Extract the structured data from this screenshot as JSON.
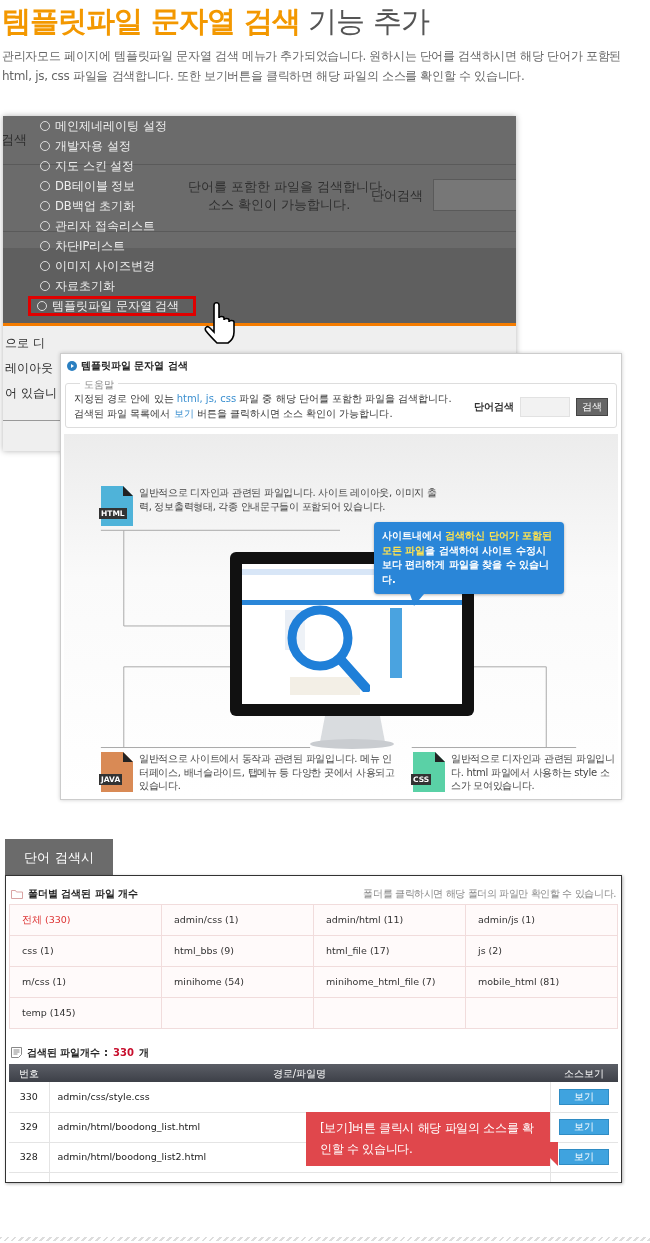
{
  "heading": {
    "highlight": "템플릿파일 문자열 검색",
    "rest": "기능 추가"
  },
  "intro": "관리자모드 페이지에 템플릿파일 문자열 검색 메뉴가 추가되었습니다. 원하시는 단어를 검색하시면 해당 단어가 포함된 html, js, css 파일을 검색합니다. 또한 보기버튼을 클릭하면 해당 파일의 소스를 확인할 수 있습니다.",
  "admin_screenshot": {
    "title_fragment": "검색",
    "help_fragments": [
      "단어를 포함한 파일을 검색합니다.",
      "소스 확인이 가능합니다."
    ],
    "search_label": "단어검색",
    "lower_fragments": [
      "으로 디",
      "레이아웃",
      "어 있습니"
    ],
    "menu": [
      {
        "label": "메인제네레이팅 설정",
        "selected": false
      },
      {
        "label": "개발자용 설정",
        "selected": false
      },
      {
        "label": "지도 스킨 설정",
        "selected": false
      },
      {
        "label": "DB테이블 정보",
        "selected": false
      },
      {
        "label": "DB백업 초기화",
        "selected": false
      },
      {
        "label": "관리자 접속리스트",
        "selected": false
      },
      {
        "label": "차단IP리스트",
        "selected": false
      },
      {
        "label": "이미지 사이즈변경",
        "selected": false
      },
      {
        "label": "자료초기화",
        "selected": false
      },
      {
        "label": "템플릿파일 문자열 검색",
        "selected": true
      }
    ]
  },
  "search_screenshot": {
    "title": "템플릿파일 문자열 검색",
    "help_legend": "도움말",
    "help_lines": [
      [
        {
          "text": "지정된 경로 안에 있는 ",
          "accent": false
        },
        {
          "text": "html, js, css",
          "accent": true
        },
        {
          "text": " 파일 중 해당 단어를 포함한 파일을 검색합니다.",
          "accent": false
        }
      ],
      [
        {
          "text": "검색된 파일 목록에서 ",
          "accent": false
        },
        {
          "text": "보기",
          "accent": true
        },
        {
          "text": " 버튼을 클릭하시면 소스 확인이 가능합니다.",
          "accent": false
        }
      ]
    ],
    "search_label": "단어검색",
    "search_button": "검색",
    "file_notes": [
      {
        "kind": "html",
        "badge": "HTML",
        "color": "#4fb3d9",
        "text": "일반적으로 디자인과 관련된 파일입니다. 사이트 레이아웃, 이미지 출력, 정보출력형태, 각종 안내문구들이 포함되어 있습니다."
      },
      {
        "kind": "java",
        "badge": "JAVA",
        "color": "#d98a55",
        "text": "일반적으로 사이트에서 동작과 관련된 파일입니다. 메뉴 인터페이스, 배너슬라이드, 탭메뉴 등 다양한 곳에서 사용되고 있습니다."
      },
      {
        "kind": "css",
        "badge": "CSS",
        "color": "#5ad1a6",
        "text": "일반적으로 디자인과 관련된 파일입니다. html 파일에서 사용하는 style 소스가 모여있습니다."
      }
    ],
    "callout": [
      {
        "text": "사이트내에서 ",
        "highlight": false
      },
      {
        "text": "검색하신 단어가 포함된 모든 파일",
        "highlight": true
      },
      {
        "text": "을 검색하여 사이트 수정시 보다 편리하게 파일을 찾을 수 있습니다.",
        "highlight": false
      }
    ]
  },
  "tab": "단어 검색시",
  "folders": {
    "title": "폴더별 검색된 파일 개수",
    "note": "폴더를 클릭하시면 해당 폴더의 파일만 확인할 수 있습니다.",
    "cells": [
      {
        "label": "전체 (330)",
        "selected": true
      },
      {
        "label": "admin/css (1)",
        "selected": false
      },
      {
        "label": "admin/html (11)",
        "selected": false
      },
      {
        "label": "admin/js (1)",
        "selected": false
      },
      {
        "label": "css (1)",
        "selected": false
      },
      {
        "label": "html_bbs (9)",
        "selected": false
      },
      {
        "label": "html_file (17)",
        "selected": false
      },
      {
        "label": "js (2)",
        "selected": false
      },
      {
        "label": "m/css (1)",
        "selected": false
      },
      {
        "label": "minihome (54)",
        "selected": false
      },
      {
        "label": "minihome_html_file (7)",
        "selected": false
      },
      {
        "label": "mobile_html (81)",
        "selected": false
      },
      {
        "label": "temp (145)",
        "selected": false
      }
    ]
  },
  "results": {
    "label": "검색된 파일개수 :",
    "count": "330",
    "unit": "개",
    "columns": [
      "번호",
      "경로/파일명",
      "소스보기"
    ],
    "rows": [
      {
        "number": "330",
        "path": "admin/css/style.css",
        "button": "보기"
      },
      {
        "number": "329",
        "path": "admin/html/boodong_list.html",
        "button": "보기"
      },
      {
        "number": "328",
        "path": "admin/html/boodong_list2.html",
        "button": "보기"
      }
    ]
  },
  "tooltip": "[보기]버튼 클릭시 해당 파일의 소스를 확인할 수 있습니다."
}
